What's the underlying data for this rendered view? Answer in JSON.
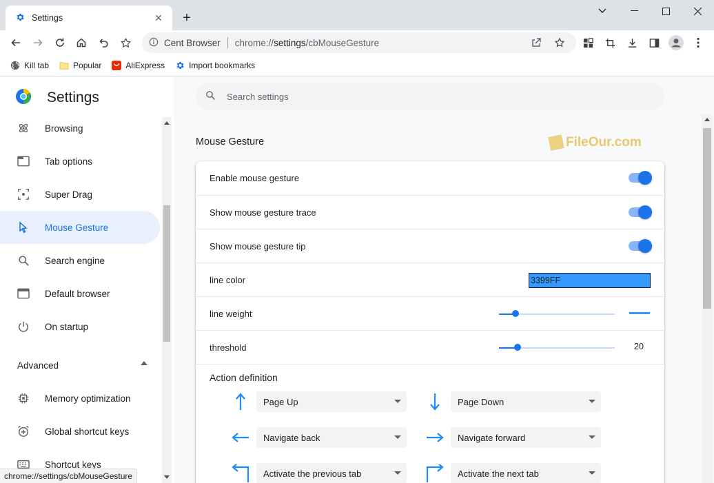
{
  "tab": {
    "title": "Settings",
    "close": "✕",
    "new_tab": "+"
  },
  "window": {
    "minimize": "—",
    "maximize": "☐",
    "close": "✕",
    "chevron": "⌄"
  },
  "omnibox": {
    "site_name": "Cent Browser",
    "url_prefix": "chrome://",
    "url_host": "settings",
    "url_path": "/cbMouseGesture"
  },
  "bookmarks": [
    {
      "label": "Kill tab",
      "icon": "globe-icon"
    },
    {
      "label": "Popular",
      "icon": "folder-icon"
    },
    {
      "label": "AliExpress",
      "icon": "aliexpress-icon"
    },
    {
      "label": "Import bookmarks",
      "icon": "gear-icon"
    }
  ],
  "sidebar": {
    "title": "Settings",
    "items": [
      {
        "label": "Browsing",
        "icon": "atom-icon"
      },
      {
        "label": "Tab options",
        "icon": "tab-icon"
      },
      {
        "label": "Super Drag",
        "icon": "target-icon"
      },
      {
        "label": "Mouse Gesture",
        "icon": "cursor-icon"
      },
      {
        "label": "Search engine",
        "icon": "search-icon"
      },
      {
        "label": "Default browser",
        "icon": "browser-icon"
      },
      {
        "label": "On startup",
        "icon": "power-icon"
      }
    ],
    "advanced_label": "Advanced",
    "advanced_items": [
      {
        "label": "Memory optimization",
        "icon": "chip-icon"
      },
      {
        "label": "Global shortcut keys",
        "icon": "alarm-plus-icon"
      },
      {
        "label": "Shortcut keys",
        "icon": "keyboard-icon"
      }
    ]
  },
  "search": {
    "placeholder": "Search settings"
  },
  "section": {
    "title": "Mouse Gesture",
    "watermark": "FileOur.com",
    "rows": {
      "enable": "Enable mouse gesture",
      "trace": "Show mouse gesture trace",
      "tip": "Show mouse gesture tip",
      "line_color_label": "line color",
      "line_color_value": "3399FF",
      "line_weight_label": "line weight",
      "threshold_label": "threshold",
      "threshold_value": "20"
    },
    "toggles": {
      "enable": true,
      "trace": true,
      "tip": true
    },
    "line_weight_level": 0.14,
    "threshold_level": 0.16,
    "action_title": "Action definition",
    "actions": [
      {
        "gesture": "up",
        "label": "Page Up"
      },
      {
        "gesture": "down",
        "label": "Page Down"
      },
      {
        "gesture": "left",
        "label": "Navigate back"
      },
      {
        "gesture": "right",
        "label": "Navigate forward"
      },
      {
        "gesture": "up-left",
        "label": "Activate the previous tab"
      },
      {
        "gesture": "up-right",
        "label": "Activate the next tab"
      }
    ]
  },
  "colors": {
    "accent": "#1a73e8",
    "line_color": "#3399ff"
  },
  "status_url": "chrome://settings/cbMouseGesture"
}
